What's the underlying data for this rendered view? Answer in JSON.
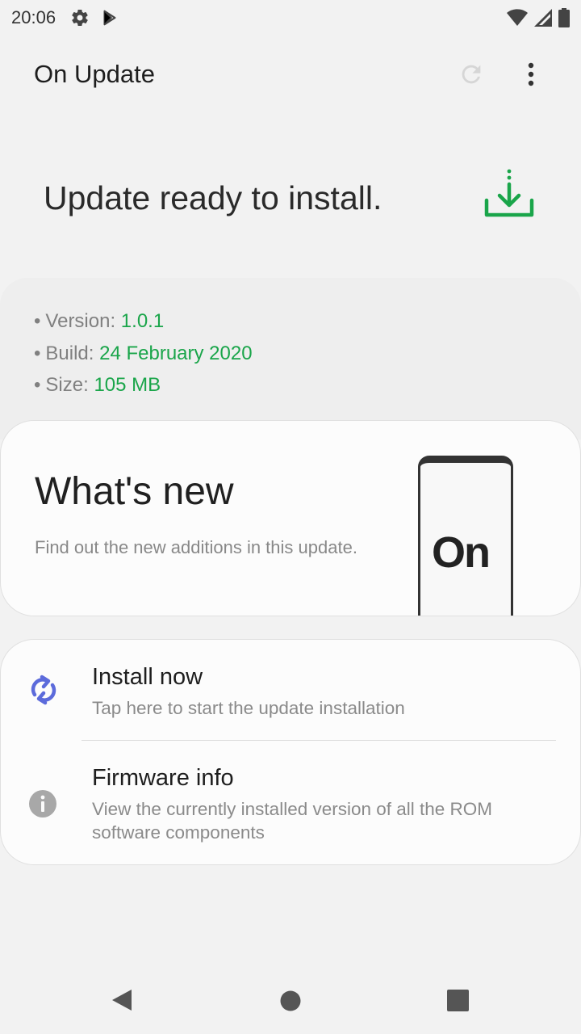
{
  "status_bar": {
    "time": "20:06",
    "icons": [
      "gear-icon",
      "play-store-icon",
      "wifi-icon",
      "signal-icon",
      "battery-icon"
    ]
  },
  "app_bar": {
    "title": "On Update",
    "actions": [
      "refresh-icon",
      "more-vert-icon"
    ]
  },
  "headline": {
    "text": "Update ready to install.",
    "icon": "download-icon",
    "icon_color": "#1aa54a"
  },
  "details": [
    {
      "label": "Version: ",
      "value": "1.0.1"
    },
    {
      "label": "Build: ",
      "value": "24 February 2020"
    },
    {
      "label": "Size: ",
      "value": "105 MB"
    }
  ],
  "whats_new": {
    "title": "What's new",
    "description": "Find out the new additions in this update.",
    "logo_text": "On"
  },
  "actions": [
    {
      "title": "Install now",
      "subtitle": "Tap here to start the update installation",
      "icon": "sync-icon",
      "icon_color": "#5c6bdb"
    },
    {
      "title": "Firmware info",
      "subtitle": "View the currently installed version of all the ROM software components",
      "icon": "info-icon",
      "icon_color": "#a8a8a8"
    }
  ],
  "colors": {
    "accent_green": "#1aa54a",
    "background": "#f2f2f2"
  },
  "nav_bar": [
    "back-icon",
    "home-icon",
    "recents-icon"
  ]
}
